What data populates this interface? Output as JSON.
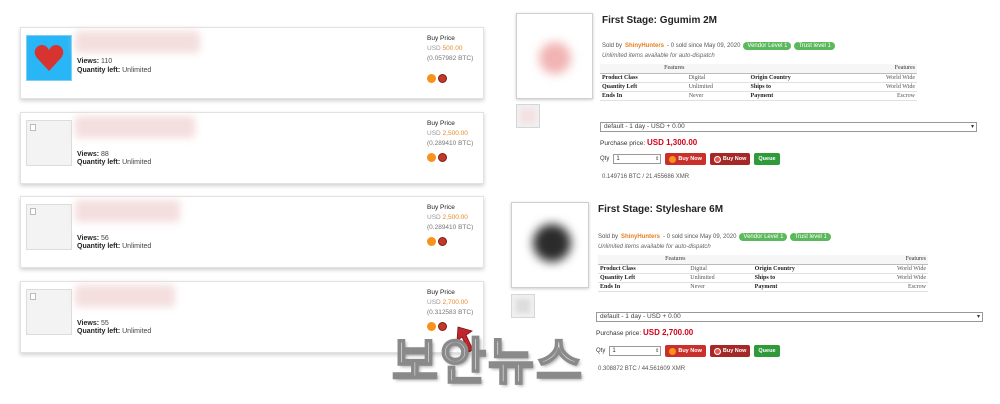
{
  "listings": [
    {
      "thumb": "heart-image",
      "views_label": "Views:",
      "views": "110",
      "qty_label": "Quantity left:",
      "qty": "Unlimited",
      "buy_label": "Buy Price",
      "usd_prefix": "USD",
      "usd": "500.00",
      "btc": "(0.057982 BTC)"
    },
    {
      "thumb": "broken-image",
      "views_label": "Views:",
      "views": "88",
      "qty_label": "Quantity left:",
      "qty": "Unlimited",
      "buy_label": "Buy Price",
      "usd_prefix": "USD",
      "usd": "2,500.00",
      "btc": "(0.289410 BTC)"
    },
    {
      "thumb": "broken-image",
      "views_label": "Views:",
      "views": "56",
      "qty_label": "Quantity left:",
      "qty": "Unlimited",
      "buy_label": "Buy Price",
      "usd_prefix": "USD",
      "usd": "2,500.00",
      "btc": "(0.289410 BTC)"
    },
    {
      "thumb": "broken-image",
      "views_label": "Views:",
      "views": "55",
      "qty_label": "Quantity left:",
      "qty": "Unlimited",
      "buy_label": "Buy Price",
      "usd_prefix": "USD",
      "usd": "2,700.00",
      "btc": "(0.312583 BTC)"
    }
  ],
  "products": [
    {
      "title": "First Stage: Ggumim 2M",
      "sold_prefix": "Sold by",
      "vendor": "ShinyHunters",
      "sold_suffix": "- 0 sold since May 09, 2020",
      "badge_vendor": "Vendor Level 1",
      "badge_trust": "Trust level 1",
      "unlimited": "Unlimited items available for auto-dispatch",
      "features_header": "Features",
      "rows": [
        {
          "k1": "Product Class",
          "v1": "Digital",
          "k2": "Origin Country",
          "v2": "World Wide"
        },
        {
          "k1": "Quantity Left",
          "v1": "Unlimited",
          "k2": "Ships to",
          "v2": "World Wide"
        },
        {
          "k1": "Ends In",
          "v1": "Never",
          "k2": "Payment",
          "v2": "Escrow"
        }
      ],
      "select": "default - 1 day - USD + 0.00",
      "purchase_label": "Purchase price:",
      "purchase_amount": "USD 1,300.00",
      "qty_label": "Qty",
      "qty_value": "1",
      "buy_btc": "Buy Now",
      "buy_xmr": "Buy Now",
      "queue": "Queue",
      "rate": "0.149716 BTC / 21.455686 XMR"
    },
    {
      "title": "First Stage: Styleshare 6M",
      "sold_prefix": "Sold by",
      "vendor": "ShinyHunters",
      "sold_suffix": "- 0 sold since May 09, 2020",
      "badge_vendor": "Vendor Level 1",
      "badge_trust": "Trust level 1",
      "unlimited": "Unlimited items available for auto-dispatch",
      "features_header": "Features",
      "rows": [
        {
          "k1": "Product Class",
          "v1": "Digital",
          "k2": "Origin Country",
          "v2": "World Wide"
        },
        {
          "k1": "Quantity Left",
          "v1": "Unlimited",
          "k2": "Ships to",
          "v2": "World Wide"
        },
        {
          "k1": "Ends In",
          "v1": "Never",
          "k2": "Payment",
          "v2": "Escrow"
        }
      ],
      "select": "default - 1 day - USD + 0.00",
      "purchase_label": "Purchase price:",
      "purchase_amount": "USD 2,700.00",
      "qty_label": "Qty",
      "qty_value": "1",
      "buy_btc": "Buy Now",
      "buy_xmr": "Buy Now",
      "queue": "Queue",
      "rate": "0.308872 BTC / 44.561609 XMR"
    }
  ],
  "watermark": "보안뉴스",
  "colors": {
    "vendor": "#e67e22",
    "badge": "#5cb85c",
    "price_red": "#d0021b",
    "btc": "#f7931a",
    "xmr": "#c0392b"
  }
}
